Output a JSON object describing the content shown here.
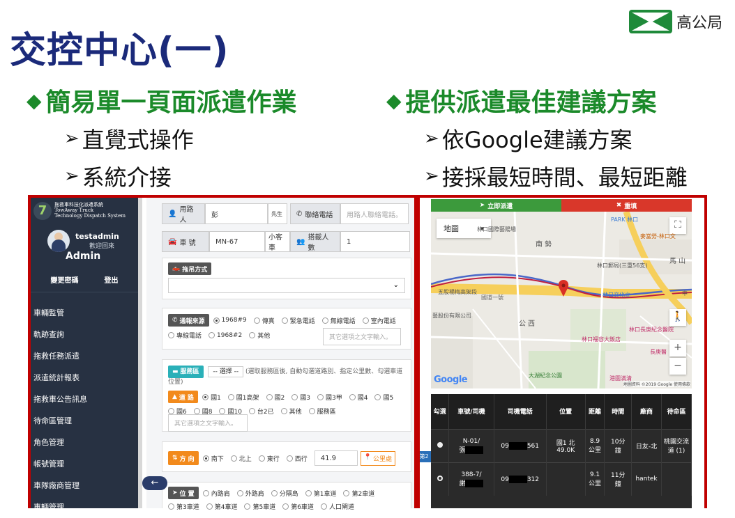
{
  "slide": {
    "title": "交控中心(一)",
    "org": "高公局",
    "left_bullet": "簡易單一頁面派遣作業",
    "left_subs": [
      "直覺式操作",
      "系統介接"
    ],
    "right_bullet": "提供派遣最佳建議方案",
    "right_subs": [
      "依Google建議方案",
      "接採最短時間、最短距離"
    ],
    "diamond": "◆",
    "arrow": "➢"
  },
  "sidebar": {
    "logo_lines": [
      "拖救車科技化派遣系統",
      "TowAway Truck",
      "Technology Dispatch System"
    ],
    "username": "testadmin",
    "welcome": "歡迎回來",
    "role": "Admin",
    "change_password": "變更密碼",
    "logout": "登出",
    "menu": [
      "車輛監管",
      "軌跡查詢",
      "拖救任務派遣",
      "派遣統計報表",
      "拖救車公告訊息",
      "待命區管理",
      "角色管理",
      "帳號管理",
      "車隊廠商管理",
      "車輛管理"
    ]
  },
  "form": {
    "caller_label": "用路人",
    "caller_value": "彭",
    "caller_suffix": "先生",
    "phone_label": "聯絡電話",
    "phone_placeholder": "用路人聯絡電話。",
    "plate_label": "車 號",
    "plate_value": "MN-67",
    "car_type": "小客車",
    "passengers_label": "搭載人數",
    "passengers_value": "1",
    "tow_method_label": "拖吊方式",
    "source_label": "通報來源",
    "source_options": [
      "1968#9",
      "傳真",
      "緊急電話",
      "無線電話",
      "室內電話",
      "專線電話",
      "1968#2",
      "其他"
    ],
    "source_other_placeholder": "其它選項之文字輸入。",
    "service_label": "服務區",
    "service_select": "-- 選擇 --",
    "service_hint": "(選取服務區後, 自動勾選道路別、指定公里數、勾選車道位置)",
    "road_label": "道 路",
    "road_options": [
      "國1",
      "國1高架",
      "國2",
      "國3",
      "國3甲",
      "國4",
      "國5",
      "國6",
      "國8",
      "國10",
      "台2已",
      "其他",
      "服務區"
    ],
    "road_other_placeholder": "其它選項之文字輸入。",
    "direction_label": "方 向",
    "direction_options": [
      "南下",
      "北上",
      "東行",
      "西行"
    ],
    "km_value": "41.9",
    "km_label": "公里處",
    "side_tag": "第2",
    "position_label": "位 置",
    "position_options": [
      "內路肩",
      "外路肩",
      "分隔島",
      "第1車道",
      "第2車道",
      "第3車道",
      "第4車道",
      "第5車道",
      "第6車道",
      "人口閘道"
    ],
    "collapse_arrow": "←"
  },
  "right": {
    "dispatch_now": "立即派遣",
    "refill": "重填",
    "map_type": "地圖",
    "google": "Google",
    "map_copyright": "地圖資料 ©2019 Google 使用條款",
    "map_labels": [
      "林口國際藝陽場",
      "PARK 林口",
      "麥當勞-林口文",
      "林口郵局(三重56支)",
      "五股楊梅高架段",
      "國道一號",
      "林口文化立",
      "藝股份有限公司",
      "公 西",
      "林口長庚紀念醫院",
      "林口福容大飯店",
      "長庚醫",
      "大湖紀念公園",
      "南 勢",
      "港園滿清",
      "馬 山",
      "中"
    ],
    "table_headers": [
      "勾選",
      "車號/司機",
      "司機電話",
      "位置",
      "距離",
      "時間",
      "廠商",
      "待命區"
    ],
    "rows": [
      {
        "plate": "N-01/",
        "driver": "張",
        "phone_pre": "09",
        "phone_post": "561",
        "pos": "國1 北 49.0K",
        "dist": "8.9 公里",
        "time": "10分 鐘",
        "vendor": "日友-北",
        "zone": "桃園交流道 (1)"
      },
      {
        "plate": "388-7/",
        "driver": "謝",
        "phone_pre": "09",
        "phone_post": "312",
        "pos": "",
        "dist": "9.1 公里",
        "time": "11分 鐘",
        "vendor": "hantek",
        "zone": ""
      }
    ]
  }
}
